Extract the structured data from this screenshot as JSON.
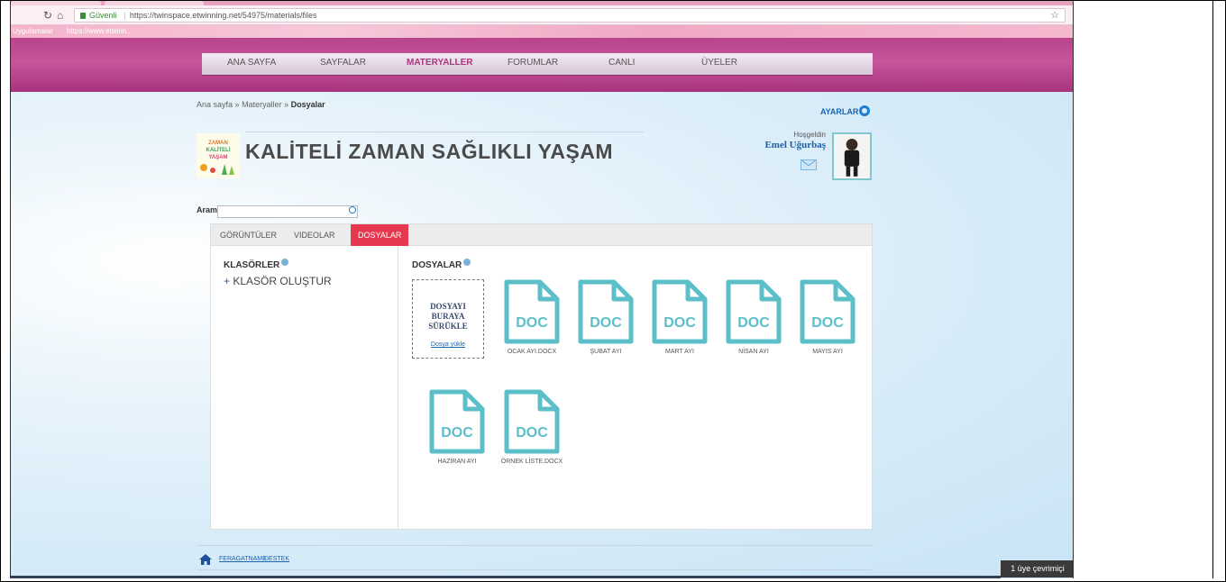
{
  "browser": {
    "secure_label": "Güvenli",
    "url": "https://twinspace.etwinning.net/54975/materials/files",
    "bookmarks": [
      "Uygulamalar",
      "https://www.etwinn..."
    ]
  },
  "nav": {
    "items": [
      {
        "label": "ANA SAYFA"
      },
      {
        "label": "SAYFALAR"
      },
      {
        "label": "MATERYALLER",
        "active": true
      },
      {
        "label": "FORUMLAR"
      },
      {
        "label": "CANLI"
      },
      {
        "label": "ÜYELER"
      }
    ]
  },
  "breadcrumb": {
    "home": "Ana sayfa",
    "sep": "»",
    "materials": "Materyaller",
    "current": "Dosyalar"
  },
  "settings_label": "AYARLAR",
  "project": {
    "title": "KALİTELİ ZAMAN SAĞLIKLI YAŞAM",
    "logo_text": "ZAMAN KALİTELİ YAŞAM"
  },
  "user": {
    "welcome": "Hoşgeldin",
    "name": "Emel Uğurbaş"
  },
  "search": {
    "label": "Arama",
    "value": ""
  },
  "tabs": [
    {
      "label": "GÖRÜNTÜLER"
    },
    {
      "label": "VIDEOLAR"
    },
    {
      "label": "DOSYALAR",
      "active": true
    }
  ],
  "folders": {
    "title": "KLASÖRLER",
    "create_label": "KLASÖR OLUŞTUR"
  },
  "files": {
    "title": "DOSYALAR",
    "dropzone_lines": [
      "DOSYAYI",
      "BURAYA",
      "SÜRÜKLE"
    ],
    "upload_link": "Dosya yükle",
    "doc_badge": "DOC",
    "items": [
      {
        "name": "OCAK AYI.DOCX"
      },
      {
        "name": "ŞUBAT AYI"
      },
      {
        "name": "MART AYI"
      },
      {
        "name": "NİSAN AYI"
      },
      {
        "name": "MAYIS AYI"
      },
      {
        "name": "HAZİRAN AYI"
      },
      {
        "name": "ÖRNEK LİSTE.DOCX"
      }
    ]
  },
  "footer": {
    "links": [
      "FERAGATNAME",
      "DESTEK"
    ]
  },
  "online_status": "1 üye çevrimiçi",
  "colors": {
    "accent": "#a8387c",
    "active_tab": "#e8384f",
    "doc_icon": "#5bbfca",
    "link": "#1d63ad"
  }
}
